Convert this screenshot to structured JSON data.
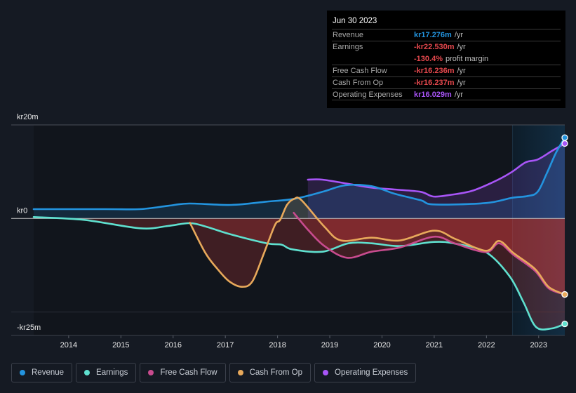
{
  "tooltip": {
    "date": "Jun 30 2023",
    "rows": [
      {
        "label": "Revenue",
        "value": "kr17.276m",
        "suffix": "/yr",
        "color": "#2394df"
      },
      {
        "label": "Earnings",
        "value": "-kr22.530m",
        "suffix": "/yr",
        "color": "#e5484d"
      },
      {
        "label": "",
        "value": "-130.4%",
        "suffix": "profit margin",
        "color": "#e5484d"
      },
      {
        "label": "Free Cash Flow",
        "value": "-kr16.236m",
        "suffix": "/yr",
        "color": "#e5484d"
      },
      {
        "label": "Cash From Op",
        "value": "-kr16.237m",
        "suffix": "/yr",
        "color": "#e5484d"
      },
      {
        "label": "Operating Expenses",
        "value": "kr16.029m",
        "suffix": "/yr",
        "color": "#a855f7"
      }
    ]
  },
  "legend": [
    {
      "label": "Revenue",
      "color": "#2394df"
    },
    {
      "label": "Earnings",
      "color": "#5fe0cf"
    },
    {
      "label": "Free Cash Flow",
      "color": "#c84b8e"
    },
    {
      "label": "Cash From Op",
      "color": "#e8a95b"
    },
    {
      "label": "Operating Expenses",
      "color": "#a855f7"
    }
  ],
  "chart_data": {
    "type": "area",
    "title": "",
    "xlabel": "",
    "ylabel": "",
    "xlim": [
      2013.33,
      2023.5
    ],
    "ylim": [
      -25,
      20
    ],
    "y_ticks": [
      {
        "value": 20,
        "label": "kr20m"
      },
      {
        "value": 0,
        "label": "kr0"
      },
      {
        "value": -25,
        "label": "-kr25m"
      }
    ],
    "gridlines": [
      20,
      -20
    ],
    "x_ticks": [
      {
        "value": 2014,
        "label": "2014"
      },
      {
        "value": 2015,
        "label": "2015"
      },
      {
        "value": 2016,
        "label": "2016"
      },
      {
        "value": 2017,
        "label": "2017"
      },
      {
        "value": 2018,
        "label": "2018"
      },
      {
        "value": 2019,
        "label": "2019"
      },
      {
        "value": 2020,
        "label": "2020"
      },
      {
        "value": 2021,
        "label": "2021"
      },
      {
        "value": 2022,
        "label": "2022"
      },
      {
        "value": 2023,
        "label": "2023"
      }
    ],
    "highlight_range": [
      2022.5,
      2023.5
    ],
    "negative_fill_color": "#e53e3e",
    "units": "kr millions",
    "series": [
      {
        "name": "Operating Expenses",
        "key": "opex",
        "color": "#a855f7",
        "points": [
          [
            2018.58,
            8.3
          ],
          [
            2018.86,
            8.3
          ],
          [
            2019.36,
            7.4
          ],
          [
            2019.8,
            6.6
          ],
          [
            2020.24,
            6.2
          ],
          [
            2020.74,
            5.7
          ],
          [
            2020.98,
            4.7
          ],
          [
            2021.28,
            5.0
          ],
          [
            2021.72,
            5.9
          ],
          [
            2022.17,
            8.0
          ],
          [
            2022.48,
            9.9
          ],
          [
            2022.75,
            12.0
          ],
          [
            2022.98,
            12.6
          ],
          [
            2023.25,
            14.4
          ],
          [
            2023.5,
            16.029
          ]
        ]
      },
      {
        "name": "Revenue",
        "key": "revenue",
        "color": "#2394df",
        "points": [
          [
            2013.33,
            2.0
          ],
          [
            2014.7,
            2.0
          ],
          [
            2015.37,
            2.0
          ],
          [
            2015.9,
            2.7
          ],
          [
            2016.31,
            3.2
          ],
          [
            2017.11,
            2.9
          ],
          [
            2017.79,
            3.6
          ],
          [
            2018.32,
            4.2
          ],
          [
            2018.86,
            5.7
          ],
          [
            2019.3,
            7.1
          ],
          [
            2019.8,
            6.9
          ],
          [
            2020.24,
            5.3
          ],
          [
            2020.74,
            3.9
          ],
          [
            2021.0,
            3.0
          ],
          [
            2021.99,
            3.3
          ],
          [
            2022.48,
            4.4
          ],
          [
            2022.79,
            4.8
          ],
          [
            2022.98,
            5.7
          ],
          [
            2023.15,
            9.5
          ],
          [
            2023.33,
            14.0
          ],
          [
            2023.5,
            17.276
          ]
        ]
      },
      {
        "name": "Earnings",
        "key": "earnings",
        "color": "#5fe0cf",
        "points": [
          [
            2013.33,
            0.3
          ],
          [
            2014.3,
            -0.3
          ],
          [
            2015.37,
            -2.1
          ],
          [
            2015.9,
            -1.6
          ],
          [
            2016.31,
            -1.0
          ],
          [
            2016.62,
            -1.7
          ],
          [
            2017.07,
            -3.3
          ],
          [
            2017.79,
            -5.3
          ],
          [
            2018.08,
            -5.6
          ],
          [
            2018.28,
            -6.6
          ],
          [
            2018.86,
            -7.1
          ],
          [
            2019.36,
            -5.3
          ],
          [
            2019.8,
            -5.3
          ],
          [
            2020.34,
            -5.9
          ],
          [
            2021.0,
            -5.0
          ],
          [
            2021.41,
            -5.4
          ],
          [
            2021.99,
            -7.2
          ],
          [
            2022.44,
            -12.3
          ],
          [
            2022.71,
            -17.9
          ],
          [
            2022.95,
            -23.2
          ],
          [
            2023.25,
            -23.5
          ],
          [
            2023.5,
            -22.53
          ]
        ]
      },
      {
        "name": "Free Cash Flow",
        "key": "fcf",
        "color": "#c84b8e",
        "points": [
          [
            2018.31,
            1.2
          ],
          [
            2018.59,
            -2.5
          ],
          [
            2018.9,
            -5.9
          ],
          [
            2019.33,
            -8.4
          ],
          [
            2019.8,
            -7.1
          ],
          [
            2020.34,
            -6.2
          ],
          [
            2021.0,
            -3.9
          ],
          [
            2021.41,
            -5.4
          ],
          [
            2021.99,
            -7.2
          ],
          [
            2022.24,
            -5.3
          ],
          [
            2022.52,
            -7.8
          ],
          [
            2022.93,
            -11.2
          ],
          [
            2023.19,
            -14.9
          ],
          [
            2023.5,
            -16.236
          ]
        ]
      },
      {
        "name": "Cash From Op",
        "key": "cfo",
        "color": "#e8a95b",
        "points": [
          [
            2016.32,
            -0.9
          ],
          [
            2016.62,
            -7.4
          ],
          [
            2016.85,
            -10.8
          ],
          [
            2017.07,
            -13.4
          ],
          [
            2017.32,
            -14.6
          ],
          [
            2017.52,
            -13.4
          ],
          [
            2017.74,
            -7.4
          ],
          [
            2017.95,
            -1.4
          ],
          [
            2018.05,
            -0.3
          ],
          [
            2018.18,
            2.9
          ],
          [
            2018.32,
            4.2
          ],
          [
            2018.46,
            3.9
          ],
          [
            2018.9,
            -1.8
          ],
          [
            2019.22,
            -4.7
          ],
          [
            2019.8,
            -4.1
          ],
          [
            2020.34,
            -4.7
          ],
          [
            2021.0,
            -2.6
          ],
          [
            2021.41,
            -4.4
          ],
          [
            2021.99,
            -6.9
          ],
          [
            2022.24,
            -4.8
          ],
          [
            2022.52,
            -7.4
          ],
          [
            2022.93,
            -10.8
          ],
          [
            2023.19,
            -14.6
          ],
          [
            2023.5,
            -16.237
          ]
        ]
      }
    ]
  }
}
